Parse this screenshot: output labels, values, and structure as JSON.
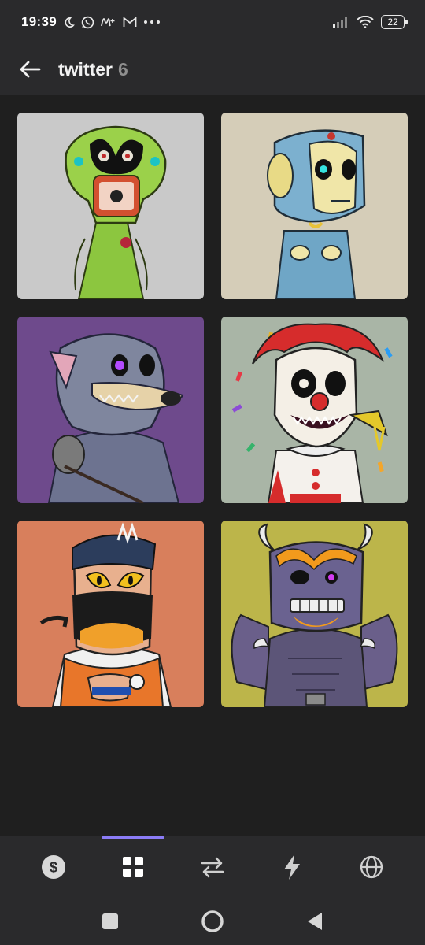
{
  "status_bar": {
    "time": "19:39",
    "battery": "22",
    "left_icons": [
      "moon-icon",
      "whatsapp-icon",
      "movistar-icon",
      "gmail-icon",
      "more-dots-icon"
    ],
    "right_icons": [
      "signal-icon",
      "wifi-icon",
      "battery-icon"
    ]
  },
  "header": {
    "title": "twitter",
    "count": "6"
  },
  "grid": {
    "items": [
      {
        "name": "green-alien-nft",
        "bg": "#c9c9c9"
      },
      {
        "name": "robot-skull-nft",
        "bg": "#d5cdb8"
      },
      {
        "name": "werewolf-nft",
        "bg": "#6e4a8c"
      },
      {
        "name": "clown-nft",
        "bg": "#a9b5a6"
      },
      {
        "name": "ninja-nft",
        "bg": "#d87f5c"
      },
      {
        "name": "demon-gargoyle-nft",
        "bg": "#bcb54a"
      }
    ]
  },
  "bottom_nav": {
    "items": [
      "dollar-icon",
      "grid-icon",
      "transfer-icon",
      "bolt-icon",
      "globe-icon"
    ],
    "active": "grid-icon"
  },
  "system_nav": [
    "square-icon",
    "circle-icon",
    "back-triangle-icon"
  ],
  "colors": {
    "background": "#1f1f1f",
    "bar": "#2a2a2c",
    "accent": "#8b7cf6"
  }
}
